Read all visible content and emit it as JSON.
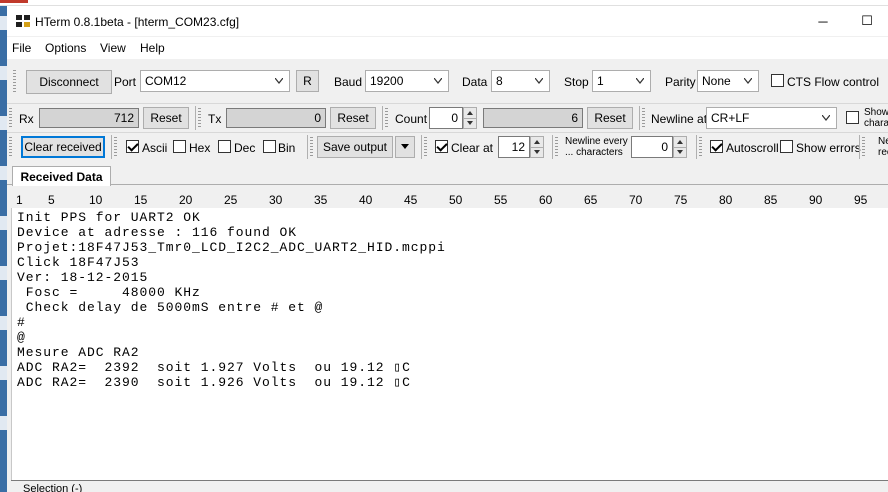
{
  "window": {
    "title": "HTerm 0.8.1beta - [hterm_COM23.cfg]",
    "minimize": "─",
    "maximize": "☐"
  },
  "menu": [
    "File",
    "Options",
    "View",
    "Help"
  ],
  "connection": {
    "disconnect_label": "Disconnect",
    "port_label": "Port",
    "port_value": "COM12",
    "refresh_label": "R",
    "baud_label": "Baud",
    "baud_value": "19200",
    "data_label": "Data",
    "data_value": "8",
    "stop_label": "Stop",
    "stop_value": "1",
    "parity_label": "Parity",
    "parity_value": "None",
    "cts_label": "CTS Flow control"
  },
  "counters": {
    "rx_label": "Rx",
    "rx_value": "712",
    "rx_reset": "Reset",
    "tx_label": "Tx",
    "tx_value": "0",
    "tx_reset": "Reset",
    "count_label": "Count",
    "count_value": "0",
    "count_field": "6",
    "count_reset": "Reset",
    "newline_at_label": "Newline at",
    "newline_at_value": "CR+LF",
    "show_label_1": "Show",
    "show_label_2": "chara"
  },
  "display": {
    "clear_received": "Clear received",
    "ascii_label": "Ascii",
    "hex_label": "Hex",
    "dec_label": "Dec",
    "bin_label": "Bin",
    "save_output": "Save output",
    "clear_at_label": "Clear at",
    "clear_at_value": "12",
    "newline_every_1": "Newline every",
    "newline_every_2": "... characters",
    "newline_every_value": "0",
    "autoscroll_label": "Autoscroll",
    "show_errors_label": "Show errors",
    "ne_1": "Ne",
    "ne_2": "rec"
  },
  "tabs": {
    "received": "Received Data"
  },
  "ruler": [
    "1",
    "5",
    "10",
    "15",
    "20",
    "25",
    "30",
    "35",
    "40",
    "45",
    "50",
    "55",
    "60",
    "65",
    "70",
    "75",
    "80",
    "85",
    "90",
    "95"
  ],
  "terminal_lines": [
    "Init PPS for UART2 OK",
    "Device at adresse : 116 found OK",
    "Projet:18F47J53_Tmr0_LCD_I2C2_ADC_UART2_HID.mcppi",
    "Click 18F47J53",
    "Ver: 18-12-2015",
    " Fosc =     48000 KHz",
    " Check delay de 5000mS entre # et @",
    "#",
    "@",
    "Mesure ADC RA2",
    "ADC RA2=  2392  soit 1.927 Volts  ou 19.12 ▯C",
    "ADC RA2=  2390  soit 1.926 Volts  ou 19.12 ▯C"
  ],
  "status": {
    "selection": "Selection (-)"
  }
}
